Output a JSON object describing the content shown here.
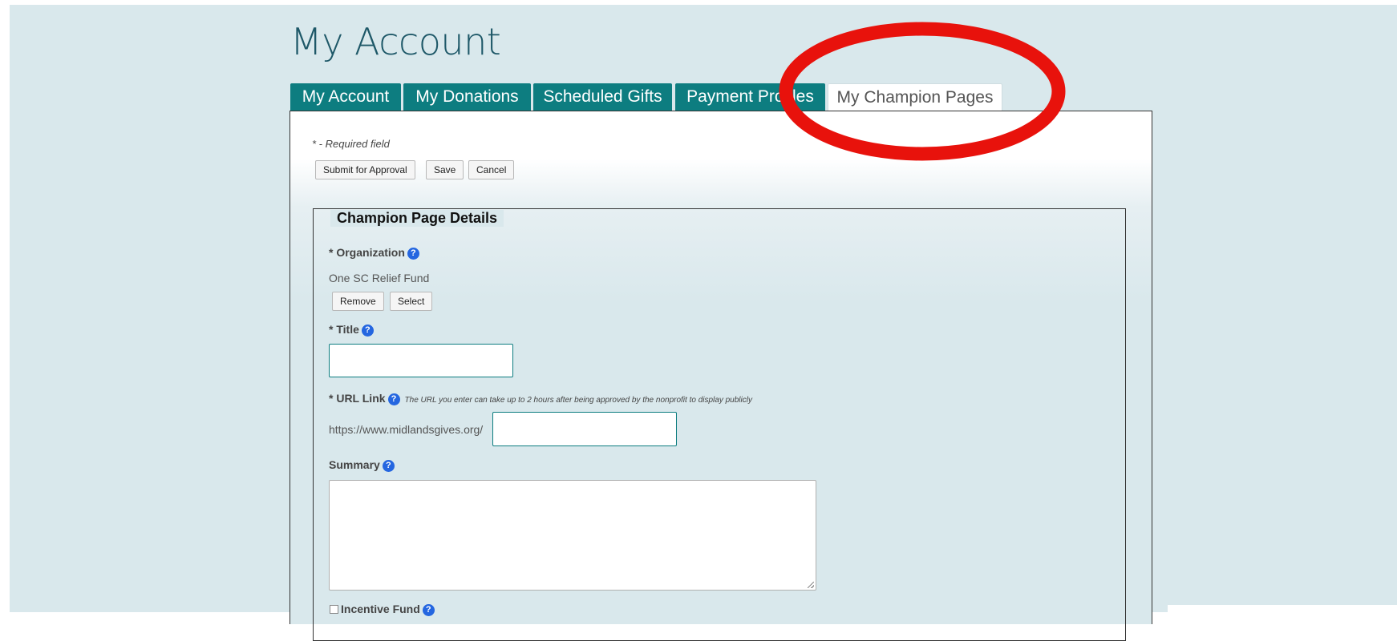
{
  "page_title": "My Account",
  "tabs": [
    {
      "label": "My Account"
    },
    {
      "label": "My Donations"
    },
    {
      "label": "Scheduled Gifts"
    },
    {
      "label": "Payment Profiles"
    },
    {
      "label": "My Champion Pages"
    }
  ],
  "active_tab": "My Champion Pages",
  "form": {
    "required_note": "* - Required field",
    "actions": {
      "submit_label": "Submit for Approval",
      "save_label": "Save",
      "cancel_label": "Cancel"
    },
    "section_title": "Champion Page Details",
    "organization": {
      "label": "* Organization",
      "value": "One SC Relief Fund",
      "remove_label": "Remove",
      "select_label": "Select"
    },
    "title_field": {
      "label": "* Title",
      "value": ""
    },
    "url_field": {
      "label": "* URL Link",
      "hint": "The URL you enter can take up to 2 hours after being approved by the nonprofit to display publicly",
      "prefix": "https://www.midlandsgives.org/",
      "value": ""
    },
    "summary_field": {
      "label": "Summary",
      "value": ""
    },
    "incentive_fund": {
      "label": "Incentive Fund",
      "checked": false
    }
  },
  "help_glyph": "?",
  "annotation": {
    "shape": "ellipse",
    "color": "#e8120c",
    "target": "My Champion Pages tab"
  }
}
